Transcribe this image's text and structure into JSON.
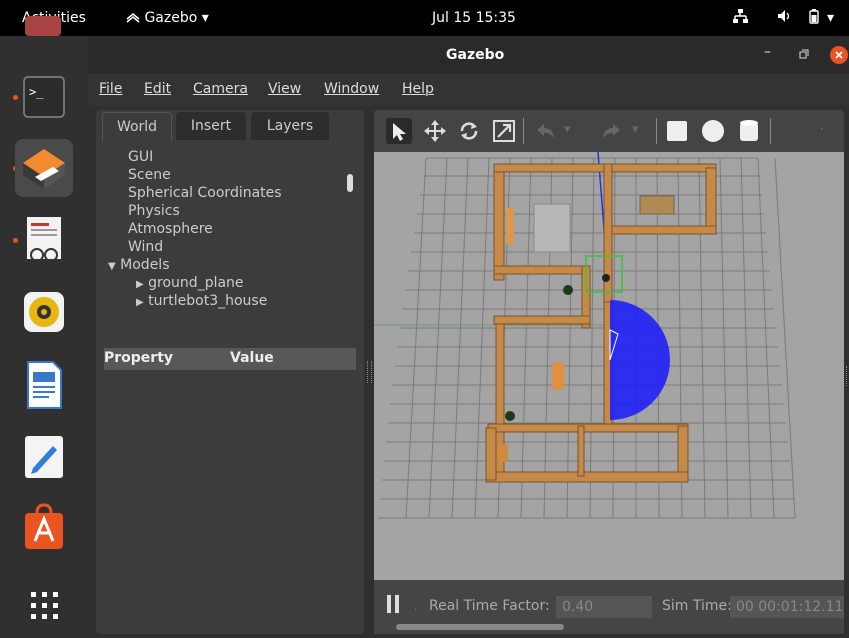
{
  "topbar": {
    "activities": "Activities",
    "app_name": "Gazebo",
    "datetime": "Jul 15  15:35"
  },
  "window": {
    "title": "Gazebo"
  },
  "menu": [
    "File",
    "Edit",
    "Camera",
    "View",
    "Window",
    "Help"
  ],
  "left_panel": {
    "tabs": [
      "World",
      "Insert",
      "Layers"
    ],
    "active_tab": "World",
    "tree": [
      "GUI",
      "Scene",
      "Spherical Coordinates",
      "Physics",
      "Atmosphere",
      "Wind",
      "Models",
      "ground_plane",
      "turtlebot3_house"
    ],
    "property_header": {
      "property": "Property",
      "value": "Value"
    }
  },
  "bottom": {
    "rtf_label": "Real Time Factor:",
    "rtf_value": "0.40",
    "sim_label": "Sim Time:",
    "sim_value": "00 00:01:12.11"
  },
  "dock_apps": [
    "terminal-icon",
    "gazebo-icon",
    "document-viewer-icon",
    "rhythmbox-icon",
    "writer-icon",
    "text-editor-icon",
    "software-center-icon",
    "show-apps-icon"
  ],
  "colors": {
    "accent": "#e95420",
    "scene_bg": "#a4a4a4",
    "laser": "#1a1aff"
  }
}
